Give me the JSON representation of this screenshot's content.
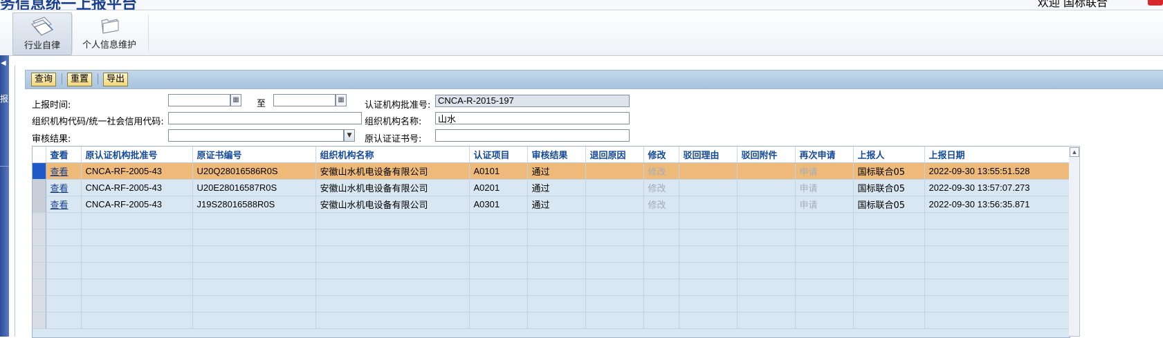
{
  "header": {
    "title_fragment": "务信息统一上报平台",
    "right_text_fragment": "欢迎  国标联合"
  },
  "toolbar": {
    "items": [
      {
        "label": "行业自律",
        "icon": "documents-icon",
        "active": true
      },
      {
        "label": "个人信息维护",
        "icon": "folder-icon",
        "active": false
      }
    ]
  },
  "left_bar": {
    "label_fragment": "报"
  },
  "actions": {
    "query": "查询",
    "reset": "重置",
    "export": "导出"
  },
  "form": {
    "report_time_label": "上报时间:",
    "date_from": "",
    "to_label": "至",
    "date_to": "",
    "cert_body_approval_label": "认证机构批准号:",
    "cert_body_approval_value": "CNCA-R-2015-197",
    "org_code_label": "组织机构代码/统一社会信用代码:",
    "org_code_value": "",
    "org_name_label": "组织机构名称:",
    "org_name_value": "山水",
    "review_result_label": "审核结果:",
    "review_result_value": "",
    "orig_cert_no_label": "原认证证书号:",
    "orig_cert_no_value": ""
  },
  "grid": {
    "columns": [
      "查看",
      "原认证机构批准号",
      "原证书编号",
      "组织机构名称",
      "认证项目",
      "审核结果",
      "退回原因",
      "修改",
      "驳回理由",
      "驳回附件",
      "再次申请",
      "上报人",
      "上报日期"
    ],
    "rows": [
      {
        "view": "查看",
        "orig_approval": "CNCA-RF-2005-43",
        "orig_cert": "U20Q28016586R0S",
        "org": "安徽山水机电设备有限公司",
        "project": "A0101",
        "result": "通过",
        "return_reason": "",
        "modify": "修改",
        "reject_reason": "",
        "reject_attach": "",
        "reapply": "申请",
        "reporter": "国标联合05",
        "date": "2022-09-30 13:55:51.528",
        "selected": true
      },
      {
        "view": "查看",
        "orig_approval": "CNCA-RF-2005-43",
        "orig_cert": "U20E28016587R0S",
        "org": "安徽山水机电设备有限公司",
        "project": "A0201",
        "result": "通过",
        "return_reason": "",
        "modify": "修改",
        "reject_reason": "",
        "reject_attach": "",
        "reapply": "申请",
        "reporter": "国标联合05",
        "date": "2022-09-30 13:57:07.273",
        "selected": false
      },
      {
        "view": "查看",
        "orig_approval": "CNCA-RF-2005-43",
        "orig_cert": "J19S28016588R0S",
        "org": "安徽山水机电设备有限公司",
        "project": "A0301",
        "result": "通过",
        "return_reason": "",
        "modify": "修改",
        "reject_reason": "",
        "reject_attach": "",
        "reapply": "申请",
        "reporter": "国标联合05",
        "date": "2022-09-30 13:56:35.871",
        "selected": false
      }
    ]
  }
}
